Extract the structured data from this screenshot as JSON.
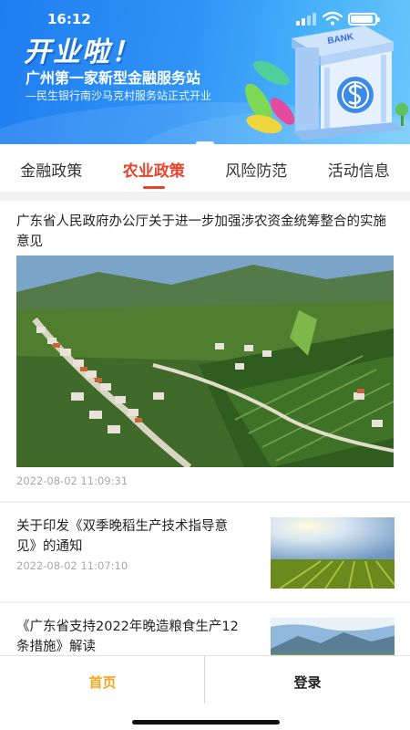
{
  "status_bar": {
    "time": "16:12"
  },
  "banner": {
    "headline": "开业啦！",
    "title": "广州第一家新型金融服务站",
    "subtitle": "—民生银行南沙马克村服务站正式开业",
    "bank_sign": "BANK",
    "colors": {
      "start": "#1e7df0",
      "end": "#6cc7fb"
    }
  },
  "tabs": [
    {
      "label": "金融政策",
      "active": false
    },
    {
      "label": "农业政策",
      "active": true
    },
    {
      "label": "风险防范",
      "active": false
    },
    {
      "label": "活动信息",
      "active": false
    }
  ],
  "articles": [
    {
      "title": "广东省人民政府办公厅关于进一步加强涉农资金统筹整合的实施意见",
      "date": "2022-08-02 11:09:31",
      "image": "aerial-village-farmland"
    },
    {
      "title": "关于印发《双季晚稻生产技术指导意见》的通知",
      "date": "2022-08-02 11:07:10",
      "image": "sunlit-crop-field"
    },
    {
      "title": "《广东省支持2022年晚造粮食生产12条措施》解读",
      "date": "",
      "image": "mountain-meadow"
    }
  ],
  "bottom_nav": {
    "home": "首页",
    "login": "登录"
  },
  "accent_colors": {
    "active_tab": "#e8432b",
    "active_nav": "#f5a623"
  }
}
